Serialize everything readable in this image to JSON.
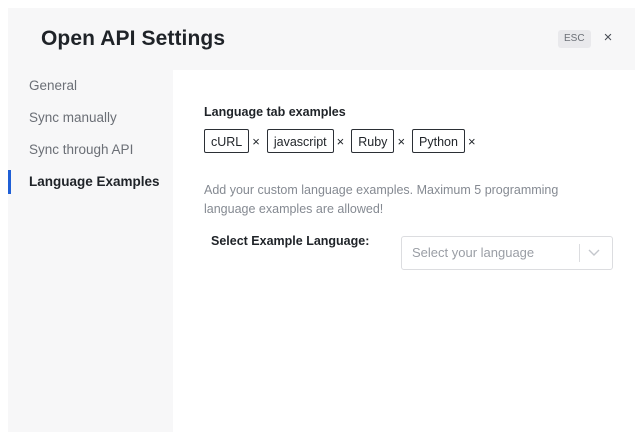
{
  "header": {
    "title": "Open API Settings",
    "esc_label": "ESC",
    "close_symbol": "×"
  },
  "sidebar": {
    "items": [
      {
        "label": "General",
        "active": false
      },
      {
        "label": "Sync manually",
        "active": false
      },
      {
        "label": "Sync through API",
        "active": false
      },
      {
        "label": "Language Examples",
        "active": true
      }
    ]
  },
  "main": {
    "section_label": "Language tab examples",
    "tags": [
      {
        "label": "cURL",
        "remove": "×"
      },
      {
        "label": "javascript",
        "remove": "×"
      },
      {
        "label": "Ruby",
        "remove": "×"
      },
      {
        "label": "Python",
        "remove": "×"
      }
    ],
    "help_text": "Add your custom language examples. Maximum 5 programming language examples are allowed!",
    "select": {
      "label": "Select Example Language:",
      "placeholder": "Select your language",
      "icon": "chevron-down-icon"
    }
  },
  "colors": {
    "accent": "#1f5fd6",
    "sidebar_bg": "#f7f7f8",
    "text_primary": "#1f2328",
    "text_muted": "#858a92"
  }
}
